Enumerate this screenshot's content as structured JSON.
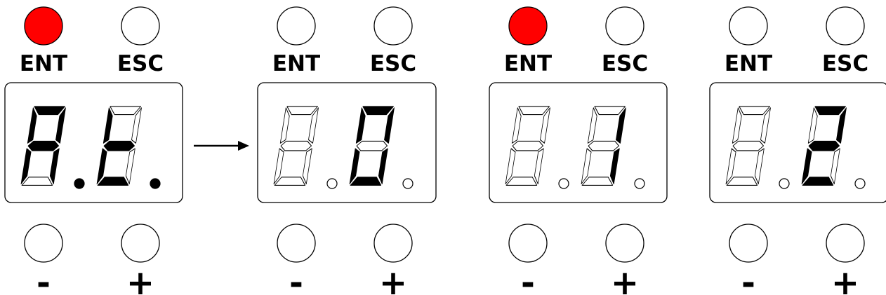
{
  "colors": {
    "led_on": "#ff0000",
    "led_off": "#ffffff",
    "segment_on": "#000000",
    "segment_off": "#ffffff",
    "outline": "#000000",
    "background": "#ffffff"
  },
  "panels": [
    {
      "top_buttons": [
        {
          "label": "ENT",
          "lit": true
        },
        {
          "label": "ESC",
          "lit": false
        }
      ],
      "digits": [
        {
          "char": "A",
          "dot": true
        },
        {
          "char": "t",
          "dot": true
        }
      ],
      "bottom_buttons": [
        {
          "label": "-"
        },
        {
          "label": "+"
        }
      ],
      "arrow_after": true
    },
    {
      "top_buttons": [
        {
          "label": "ENT",
          "lit": false
        },
        {
          "label": "ESC",
          "lit": false
        }
      ],
      "digits": [
        {
          "char": " ",
          "dot": false
        },
        {
          "char": "0",
          "dot": false
        }
      ],
      "bottom_buttons": [
        {
          "label": "-"
        },
        {
          "label": "+"
        }
      ],
      "arrow_after": false
    },
    {
      "top_buttons": [
        {
          "label": "ENT",
          "lit": true
        },
        {
          "label": "ESC",
          "lit": false
        }
      ],
      "digits": [
        {
          "char": " ",
          "dot": false
        },
        {
          "char": "1",
          "dot": false
        }
      ],
      "bottom_buttons": [
        {
          "label": "-"
        },
        {
          "label": "+"
        }
      ],
      "arrow_after": false
    },
    {
      "top_buttons": [
        {
          "label": "ENT",
          "lit": false
        },
        {
          "label": "ESC",
          "lit": false
        }
      ],
      "digits": [
        {
          "char": " ",
          "dot": false
        },
        {
          "char": "2",
          "dot": false
        }
      ],
      "bottom_buttons": [
        {
          "label": "-"
        },
        {
          "label": "+"
        }
      ],
      "arrow_after": false
    }
  ]
}
